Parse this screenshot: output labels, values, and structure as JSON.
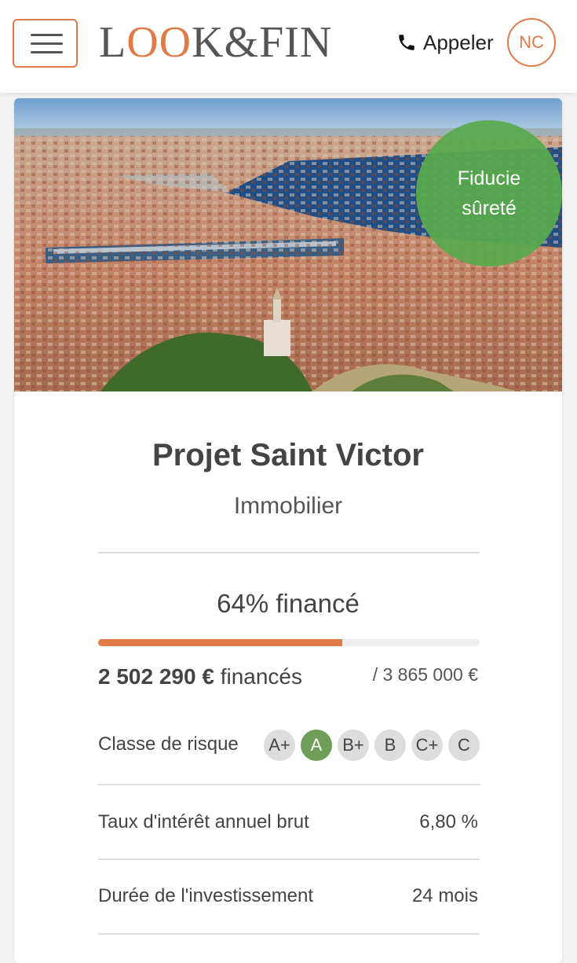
{
  "header": {
    "logo_text": "LOOK&FIN",
    "call_label": "Appeler",
    "avatar_initials": "NC",
    "accent_color": "#e07a47"
  },
  "project": {
    "badge_line1": "Fiducie",
    "badge_line2": "sûreté",
    "title": "Projet Saint Victor",
    "category": "Immobilier",
    "funded_label": "64% financé",
    "funded_fraction": 0.64,
    "raised_amount": "2 502 290 €",
    "raised_suffix": "financés",
    "goal": "/ 3 865 000 €",
    "risk_label": "Classe de risque",
    "risk_classes": [
      "A+",
      "A",
      "B+",
      "B",
      "C+",
      "C"
    ],
    "risk_selected": "A",
    "rows": [
      {
        "label": "Taux d'intérêt annuel brut",
        "value": "6,80 %"
      },
      {
        "label": "Durée de l'investissement",
        "value": "24 mois"
      }
    ]
  },
  "icons": {
    "menu": "hamburger-icon",
    "phone": "phone-icon"
  }
}
